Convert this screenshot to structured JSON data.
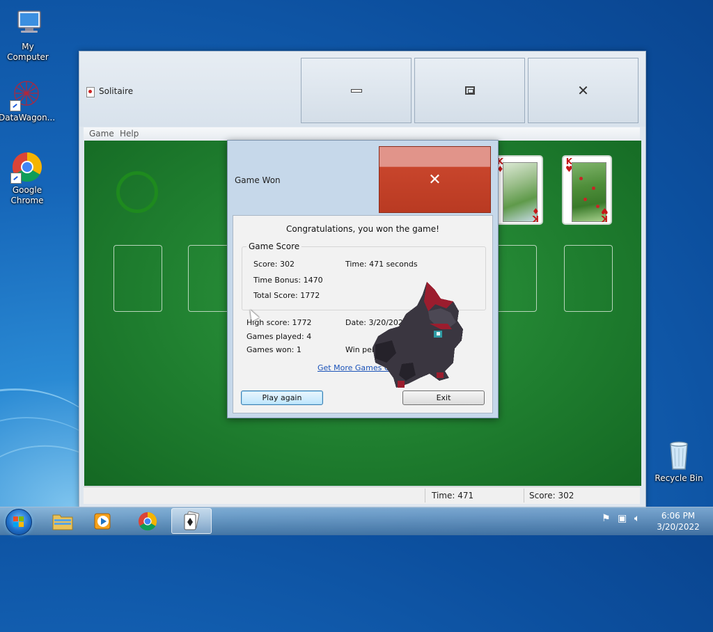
{
  "desktop": {
    "icons": [
      {
        "label": "My Computer"
      },
      {
        "label": "DataWagon..."
      },
      {
        "label": "Google Chrome"
      },
      {
        "label": "Recycle Bin"
      }
    ]
  },
  "window": {
    "title": "Solitaire",
    "controls": {
      "minimize": "minimize-icon",
      "maximize": "maximize-icon",
      "close": "close-icon"
    },
    "menu": [
      "Game",
      "Help"
    ],
    "status": {
      "time": "Time:  471",
      "score": "Score: 302"
    },
    "foundation": [
      {
        "rank": "K",
        "suit": "♦"
      },
      {
        "rank": "K",
        "suit": "♥"
      }
    ]
  },
  "dialog": {
    "title": "Game Won",
    "message": "Congratulations, you won the game!",
    "group_title": "Game Score",
    "score": "Score: 302",
    "time": "Time:  471 seconds",
    "time_bonus": "Time Bonus: 1470",
    "total_score": "Total Score: 1772",
    "high_score": "High score: 1772",
    "date": "Date: 3/20/2022",
    "games_played": "Games played: 4",
    "games_won": "Games won: 1",
    "win_percentage": "Win percentage: 25%",
    "link": "Get More Games Online",
    "play_again": "Play again",
    "exit": "Exit"
  },
  "taskbar": {
    "clock_time": "6:06 PM",
    "clock_date": "3/20/2022"
  },
  "colors": {
    "felt": "#1f7e2f",
    "desktop": "#1565b8",
    "close_red": "#c8452c",
    "link": "#1a52b8"
  }
}
